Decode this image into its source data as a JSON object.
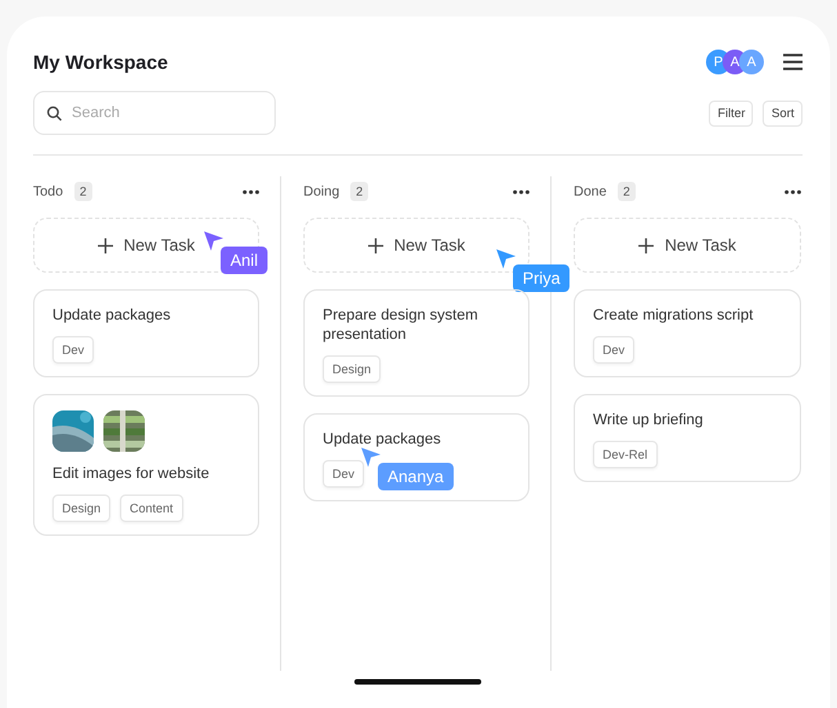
{
  "title": "My Workspace",
  "avatars": [
    {
      "initial": "P",
      "color": "#3b9bff"
    },
    {
      "initial": "A",
      "color": "#7b5cf6"
    },
    {
      "initial": "A",
      "color": "#69a6ff"
    }
  ],
  "search": {
    "placeholder": "Search"
  },
  "buttons": [
    "Filter",
    "Sort"
  ],
  "columns": [
    {
      "name": "Todo",
      "count": "2",
      "new_task": {
        "label": "New Task",
        "cursor": {
          "name": "Anil",
          "color": "#7b61ff"
        }
      },
      "cards": [
        {
          "title": "Update packages",
          "tags": [
            "Dev"
          ]
        },
        {
          "title": "Edit images for website",
          "images": [
            {
              "kind": "picture"
            },
            {
              "kind": "picture"
            }
          ],
          "tags": [
            "Design",
            "Content"
          ]
        }
      ]
    },
    {
      "name": "Doing",
      "count": "2",
      "new_task": {
        "label": "New Task",
        "cursor": {
          "name": "Priya",
          "color": "#3399ff"
        }
      },
      "cards": [
        {
          "title": "Prepare design system presentation",
          "tags": [
            "Design"
          ]
        },
        {
          "title": "Update packages",
          "tags": [
            "Dev"
          ],
          "cursor": {
            "name": "Ananya",
            "color": "#5c9dff"
          }
        }
      ]
    },
    {
      "name": "Done",
      "count": "2",
      "new_task": {
        "label": "New Task"
      },
      "cards": [
        {
          "title": "Create migrations script",
          "tags": [
            "Dev"
          ]
        },
        {
          "title": "Write up briefing",
          "tags": [
            "Dev-Rel"
          ]
        }
      ]
    }
  ]
}
